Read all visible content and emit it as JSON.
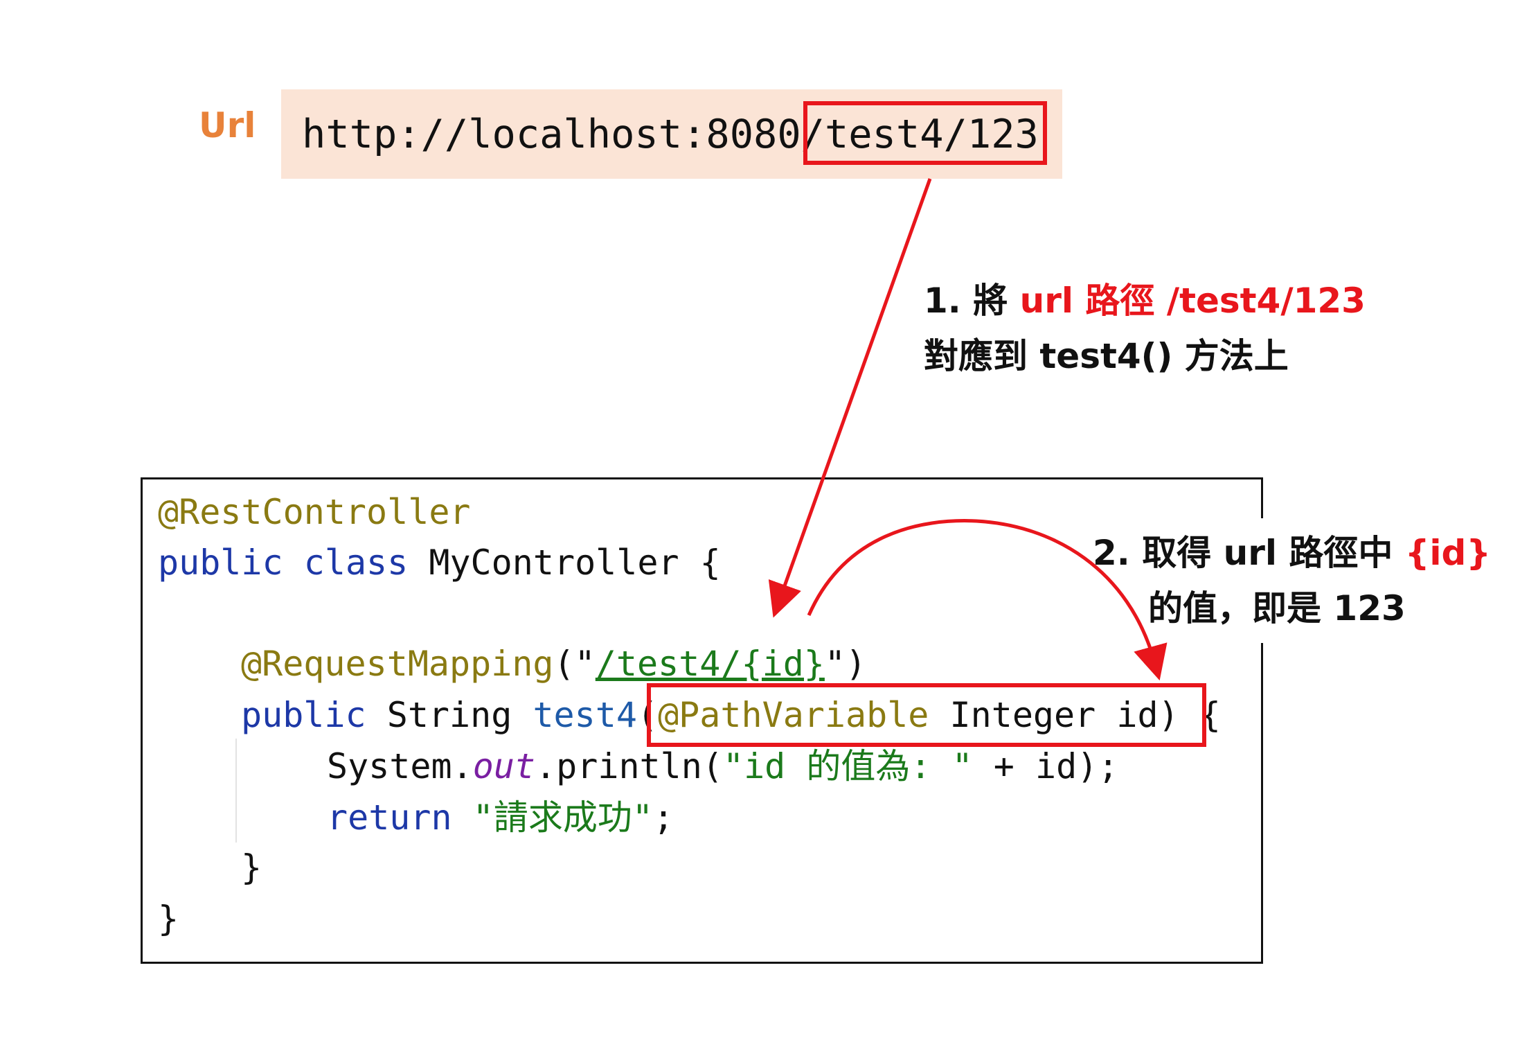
{
  "url_label": "Url",
  "url": {
    "prefix": "http://localhost:8080",
    "path": "/test4/123"
  },
  "note1": {
    "line1_prefix": "1. 將 ",
    "line1_accent": "url 路徑 /test4/123",
    "line2": "對應到 test4() 方法上"
  },
  "note2": {
    "line1_prefix": "2. 取得 url 路徑中 ",
    "line1_accent": "{id}",
    "line2": "的值，即是 123"
  },
  "code": {
    "rest_controller": "@RestController",
    "class_public": "public",
    "class_kw": "class",
    "class_name": " MyController {",
    "request_mapping": "@RequestMapping",
    "mapping_open": "(\"",
    "mapping_path": "/test4/{id}",
    "mapping_close": "\")",
    "method_public": "public",
    "method_type": " String ",
    "method_name": "test4",
    "method_paren": "(",
    "path_variable": "@PathVariable",
    "param_rest": " Integer id)",
    "method_brace": " {",
    "sysout_prefix": "System.",
    "sysout_field": "out",
    "sysout_println": ".println(",
    "sysout_string": "\"id 的值為: \"",
    "sysout_rest": " + id);",
    "return_kw": "return",
    "return_string": "\"請求成功\"",
    "return_semicolon": ";",
    "close_method": "}",
    "close_class": "}"
  },
  "colors": {
    "accent_red": "#e8161c",
    "url_label_orange": "#e8823a",
    "url_box_bg": "#fbe4d6",
    "annotation_olive": "#8a7a12",
    "keyword_blue": "#1d38a7",
    "string_green": "#1b7a1b",
    "field_purple": "#7a1fa2"
  }
}
